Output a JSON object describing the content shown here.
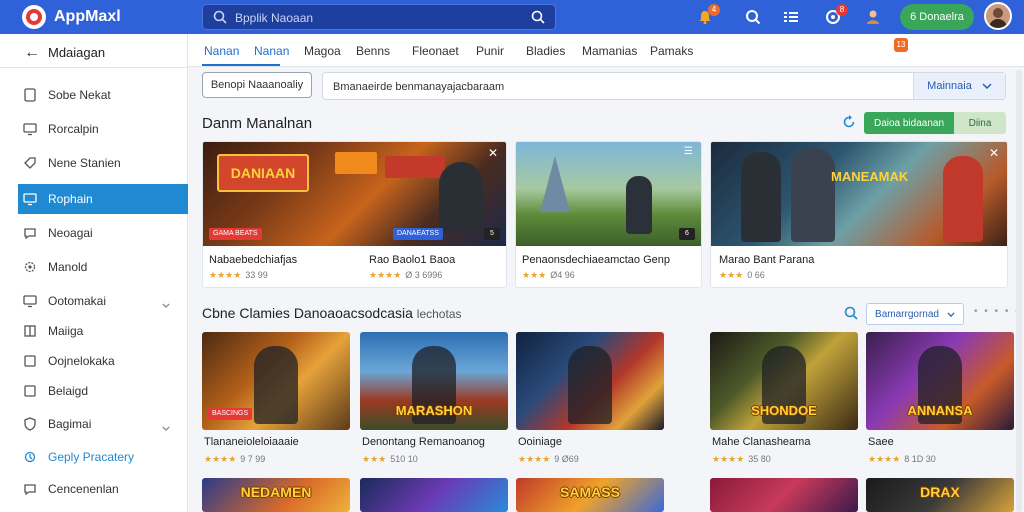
{
  "app": {
    "title": "AppMaxl"
  },
  "search": {
    "placeholder": "Bpplik Naoaan"
  },
  "topbar": {
    "badge_bell": "4",
    "badge_notif": "8",
    "cta_label": "6 Donaelra",
    "colors": {
      "bar": "#2f61d8",
      "cta": "#39a65a",
      "badge": "#f06a2a"
    }
  },
  "sidebar": {
    "back_label": "Mdaiagan",
    "items": [
      {
        "label": "Sobe Nekat",
        "icon": "tablet-icon"
      },
      {
        "label": "Rorcalpin",
        "icon": "monitor-icon"
      },
      {
        "label": "Nene Stanien",
        "icon": "tag-icon"
      },
      {
        "label": "Rophain",
        "icon": "monitor-icon",
        "active": true
      },
      {
        "label": "Neoagai",
        "icon": "chat-icon"
      },
      {
        "label": "Manold",
        "icon": "gear-icon"
      },
      {
        "label": "Ootomakai",
        "icon": "monitor-icon",
        "expandable": true
      },
      {
        "label": "Maiiga",
        "icon": "book-icon"
      },
      {
        "label": "Oojnelokaka",
        "icon": "box-icon"
      },
      {
        "label": "Belaigd",
        "icon": "box-icon"
      },
      {
        "label": "Bagimai",
        "icon": "shield-icon",
        "expandable": true
      },
      {
        "label": "Geply Pracatery",
        "icon": "wrench-icon",
        "accent": true
      },
      {
        "label": "Cencenenlan",
        "icon": "chat-icon"
      }
    ]
  },
  "tabs": [
    "Nanan",
    "Nanan",
    "Magoa",
    "Benns",
    "Fleonaet",
    "Punir",
    "Bladies",
    "Mamanias",
    "Pamaks"
  ],
  "tab_badge": "13",
  "filter": {
    "button_label": "Benopi Naaanoaliy",
    "input_value": "Bmanaeirde benmanayajacbaraam",
    "dropdown_label": "Mainnaia"
  },
  "section1": {
    "title": "Danm Manalnan",
    "green_btn_main": "Daioa bidaanan",
    "green_btn_alt": "Diina",
    "cards": [
      {
        "title_a": "Nabaebedchiafjas",
        "title_b": "Rao Baolo1 Baoa",
        "stars": "★★★★",
        "count_a": "33 99",
        "count_b": "Ø 3 6996",
        "tag": "GAMA BEATS",
        "tag_b": "DANAEATSS",
        "cnt": "5"
      },
      {
        "title_a": "Penaonsdechiaeamctao Genp",
        "stars": "★★★",
        "count_a": "Ø4 96",
        "cnt": "6"
      },
      {
        "title_a": "Marao Bant Parana",
        "stars": "★★★",
        "count_a": "0 66",
        "banner": "MANEAMAK"
      }
    ]
  },
  "section2": {
    "title": "Cbne Clamies Danoaoacsodcasia",
    "subtitle": "lechotas",
    "sort_label": "Bamarrgornad",
    "dots": "• • • • •",
    "games": [
      {
        "title": "Tlananeioleloiaaaie",
        "stars": "★★★★",
        "count": "9 7 99",
        "tag": "BASCINGS"
      },
      {
        "title": "Denontang Remanoanog",
        "stars": "★★★",
        "count": "510 10",
        "banner": "MARASHON"
      },
      {
        "title": "Ooiniage",
        "stars": "★★★★",
        "count": "9 Ø69"
      },
      {
        "title": "Mahe Clanasheama",
        "stars": "★★★★",
        "count": "35 80",
        "banner": "SHONDOE"
      },
      {
        "title": "Saee",
        "stars": "★★★★",
        "count": "8 1D 30",
        "banner": "ANNANSA"
      }
    ],
    "row3": [
      {
        "banner": "NEDAMEN"
      },
      {
        "banner": ""
      },
      {
        "banner": "SAMASS"
      },
      {
        "banner": ""
      },
      {
        "banner": "DRAX"
      }
    ]
  }
}
